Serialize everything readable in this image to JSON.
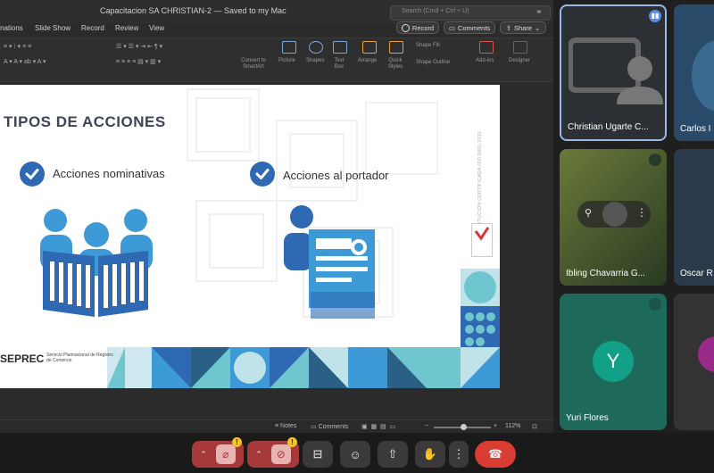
{
  "window": {
    "title": "Capacitacion SA CHRISTIAN-2 — Saved to my Mac",
    "search_placeholder": "Search (Cmd + Ctrl + U)"
  },
  "tabs": [
    "nations",
    "Slide Show",
    "Record",
    "Review",
    "View"
  ],
  "top_buttons": {
    "record": "Record",
    "comments": "Comments",
    "share": "Share"
  },
  "ribbon": {
    "convert": "Convert to SmartArt",
    "picture": "Picture",
    "shapes": "Shapes",
    "text_box": "Text Box",
    "arrange": "Arrange",
    "quick_styles": "Quick Styles",
    "shape_fill": "Shape Fill",
    "shape_outline": "Shape Outline",
    "addins": "Add-ins",
    "designer": "Designer"
  },
  "slide": {
    "title": "TIPOS DE ACCIONES",
    "item1": "Acciones nominativas",
    "item2": "Acciones al portador",
    "cert_text": "INSTITUCIÓN CERTIFICADA ISO 9001:2015",
    "logo_text": "SEPREC",
    "logo_sub": "Servicio Plurinacional de Registro de Comercio"
  },
  "status": {
    "notes": "Notes",
    "comments": "Comments",
    "zoom": "112%"
  },
  "participants": [
    {
      "name": "Christian Ugarte C...",
      "initial": ""
    },
    {
      "name": "Carlos I",
      "initial": ""
    },
    {
      "name": "Ibling Chavarria G...",
      "initial": ""
    },
    {
      "name": "Oscar R",
      "initial": ""
    },
    {
      "name": "Yuri Flores",
      "initial": "Y"
    }
  ],
  "colors": {
    "accent_blue": "#2f69b3",
    "teal_tile": "#1e6a5a",
    "end_call": "#d93c32"
  }
}
